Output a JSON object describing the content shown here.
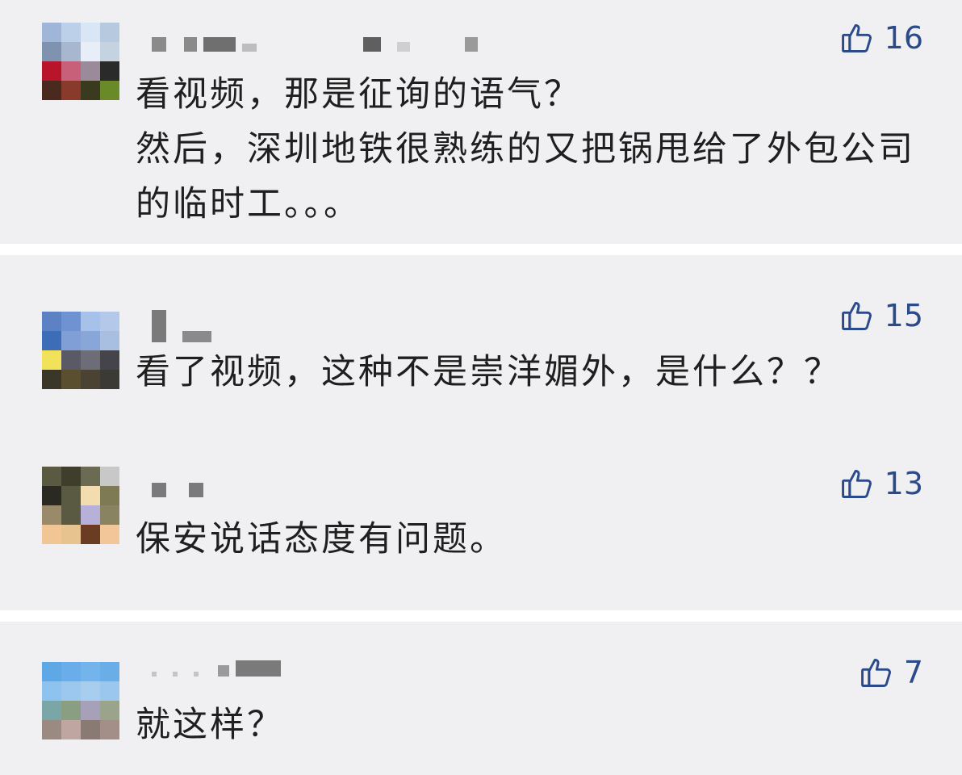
{
  "comments": [
    {
      "likes": "16",
      "text": "看视频，那是征询的语气？\n然后，深圳地铁很熟练的又把锅甩给了外包公司的临时工。。。"
    },
    {
      "likes": "15",
      "text": "看了视频，这种不是崇洋媚外，是什么？？"
    },
    {
      "likes": "13",
      "text": "保安说话态度有问题。"
    },
    {
      "likes": "7",
      "text": "就这样？"
    }
  ],
  "icons": {
    "like": "thumbs-up-icon"
  },
  "colors": {
    "card_bg": "#f0f0f3",
    "accent": "#2b4a8a",
    "text": "#1f1f1f"
  }
}
